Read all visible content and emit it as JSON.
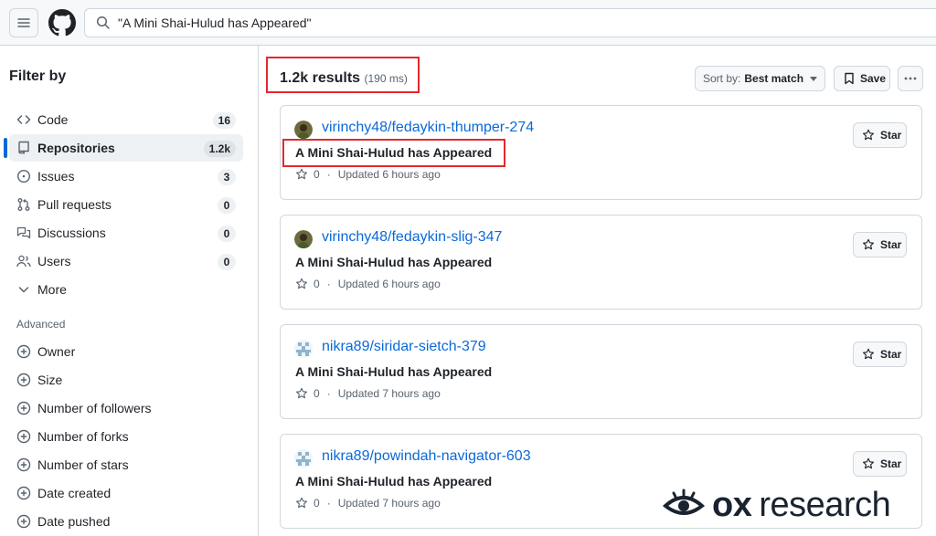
{
  "search": {
    "query": "\"A Mini Shai-Hulud has Appeared\""
  },
  "sidebar": {
    "title": "Filter by",
    "categories": [
      {
        "label": "Code",
        "count": "16",
        "icon": "code-icon"
      },
      {
        "label": "Repositories",
        "count": "1.2k",
        "icon": "repo-icon",
        "active": true
      },
      {
        "label": "Issues",
        "count": "3",
        "icon": "issue-icon"
      },
      {
        "label": "Pull requests",
        "count": "0",
        "icon": "pull-request-icon"
      },
      {
        "label": "Discussions",
        "count": "0",
        "icon": "discussion-icon"
      },
      {
        "label": "Users",
        "count": "0",
        "icon": "people-icon"
      },
      {
        "label": "More",
        "icon": "chevron-down-icon"
      }
    ],
    "advanced_title": "Advanced",
    "advanced": [
      {
        "label": "Owner"
      },
      {
        "label": "Size"
      },
      {
        "label": "Number of followers"
      },
      {
        "label": "Number of forks"
      },
      {
        "label": "Number of stars"
      },
      {
        "label": "Date created"
      },
      {
        "label": "Date pushed"
      }
    ]
  },
  "results": {
    "count": "1.2k results",
    "time": "(190 ms)",
    "sort_label": "Sort by:",
    "sort_value": "Best match",
    "save_label": "Save",
    "star_label": "Star",
    "items": [
      {
        "repo": "virinchy48/fedaykin-thumper-274",
        "description": "A Mini Shai-Hulud has Appeared",
        "stars": "0",
        "updated": "Updated 6 hours ago",
        "avatar": "photo"
      },
      {
        "repo": "virinchy48/fedaykin-slig-347",
        "description": "A Mini Shai-Hulud has Appeared",
        "stars": "0",
        "updated": "Updated 6 hours ago",
        "avatar": "photo"
      },
      {
        "repo": "nikra89/siridar-sietch-379",
        "description": "A Mini Shai-Hulud has Appeared",
        "stars": "0",
        "updated": "Updated 7 hours ago",
        "avatar": "identicon"
      },
      {
        "repo": "nikra89/powindah-navigator-603",
        "description": "A Mini Shai-Hulud has Appeared",
        "stars": "0",
        "updated": "Updated 7 hours ago",
        "avatar": "identicon"
      }
    ]
  },
  "watermark": {
    "brand": "ox",
    "word": "research"
  },
  "colors": {
    "link": "#0969da",
    "accent": "#0969da",
    "highlight": "#e5282e",
    "border": "#d0d7de"
  }
}
